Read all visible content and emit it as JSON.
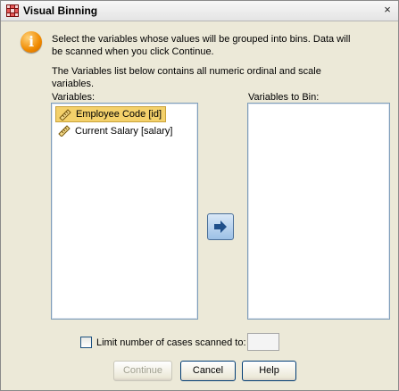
{
  "window": {
    "title": "Visual Binning",
    "close_glyph": "×"
  },
  "info": {
    "icon": "info-icon",
    "line1": "Select the variables whose values will be grouped into bins. Data will",
    "line2": "be scanned when you click Continue.",
    "line3": "The Variables list below contains all numeric ordinal and scale",
    "line4": "variables."
  },
  "variables_list": {
    "label": "Variables:",
    "items": [
      {
        "label": "Employee Code [id]",
        "icon": "scale-ruler-icon",
        "selected": true
      },
      {
        "label": "Current Salary [salary]",
        "icon": "scale-ruler-icon",
        "selected": false
      }
    ]
  },
  "bin_list": {
    "label": "Variables to Bin:",
    "items": []
  },
  "move_button": {
    "icon": "right-arrow-icon"
  },
  "limit": {
    "label": "Limit number of cases scanned to:",
    "checked": false,
    "value": ""
  },
  "buttons": {
    "continue": "Continue",
    "cancel": "Cancel",
    "help": "Help"
  },
  "colors": {
    "selection": "#f4d16b",
    "listbox_border": "#7f9db9",
    "info_icon": "#f08a00"
  }
}
